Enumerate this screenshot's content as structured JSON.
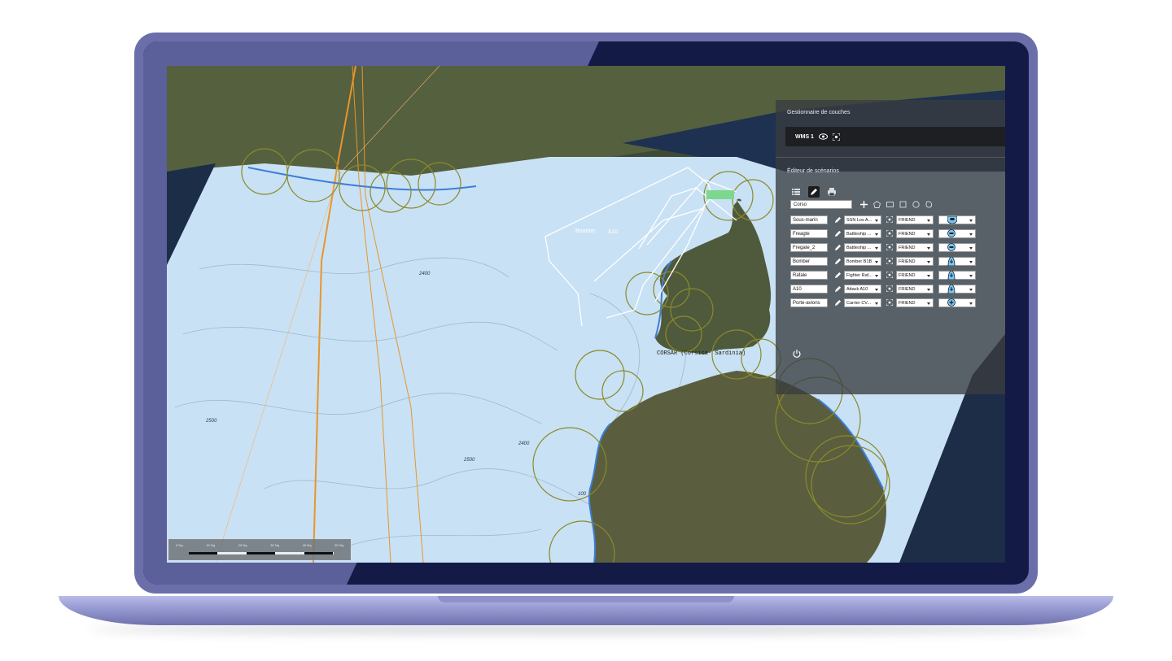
{
  "layer_manager": {
    "title": "Gestionnaire de couches",
    "layers": [
      {
        "name": "WMS 1"
      }
    ]
  },
  "scenario_editor": {
    "title": "Éditeur de scénarios",
    "scenario_name": "Corso",
    "units": [
      {
        "name": "Sous-marin",
        "type": "SSN Los A...",
        "side": "FRIEND",
        "symbol": "submarine-icon"
      },
      {
        "name": "Freagte",
        "type": "Battleship ...",
        "side": "FRIEND",
        "symbol": "surface-ship-icon"
      },
      {
        "name": "Fregate_2",
        "type": "Battleship ...",
        "side": "FRIEND",
        "symbol": "surface-ship-icon"
      },
      {
        "name": "Bomber",
        "type": "Bomber B1B",
        "side": "FRIEND",
        "symbol": "aircraft-icon"
      },
      {
        "name": "Rafale",
        "type": "Fighter Raf...",
        "side": "FRIEND",
        "symbol": "aircraft-icon"
      },
      {
        "name": "A10",
        "type": "Attack A10",
        "side": "FRIEND",
        "symbol": "aircraft-icon"
      },
      {
        "name": "Porte-avions",
        "type": "Carrier CV...",
        "side": "FRIEND",
        "symbol": "carrier-icon"
      }
    ]
  },
  "map": {
    "area_label": "CORSAR (Corsica- Sardinia)",
    "depth_labels": [
      "2500",
      "2500",
      "2400",
      "100",
      "2400"
    ],
    "track_labels": [
      "Bomber",
      "A10"
    ],
    "scale_ticks": [
      "0 Nq",
      "10 Nq",
      "20 Nq",
      "30 Nq",
      "40 Nq",
      "50 Nq"
    ]
  },
  "colors": {
    "sea": "#c9e1f4",
    "land": "#4f5a3c",
    "route": "#e8962a",
    "range_circle": "#8a8a2a",
    "panel": "#3a3c40",
    "frame": "#6b6ea8",
    "bezel": "#131a46"
  }
}
